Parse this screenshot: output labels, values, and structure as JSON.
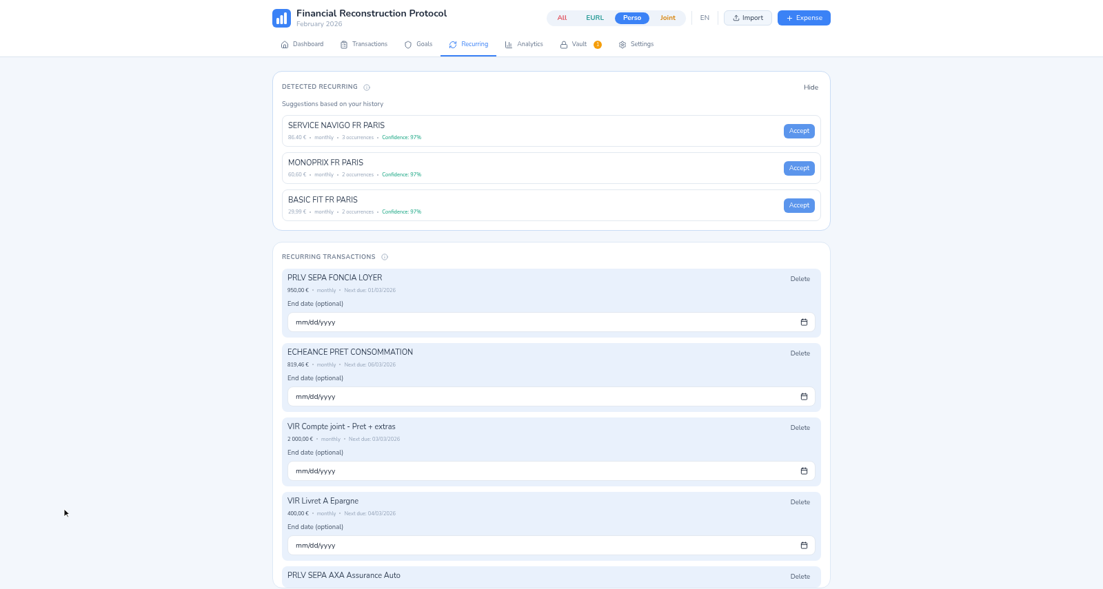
{
  "header": {
    "title": "Financial Reconstruction Protocol",
    "subtitle": "February 2026",
    "scopes": [
      {
        "label": "All",
        "selected": false,
        "color": "#e0525e"
      },
      {
        "label": "EURL",
        "selected": false,
        "color": "#2f9e9a"
      },
      {
        "label": "Perso",
        "selected": true,
        "color": "#3b82f6"
      },
      {
        "label": "Joint",
        "selected": false,
        "color": "#d9860f"
      }
    ],
    "language": "EN",
    "import": "Import",
    "expense": "Expense"
  },
  "tabs": [
    {
      "label": "Dashboard",
      "selected": false
    },
    {
      "label": "Transactions",
      "selected": false
    },
    {
      "label": "Goals",
      "selected": false
    },
    {
      "label": "Recurring",
      "selected": true
    },
    {
      "label": "Analytics",
      "selected": false
    },
    {
      "label": "Vault",
      "selected": false,
      "badge": "1"
    },
    {
      "label": "Settings",
      "selected": false
    }
  ],
  "detected": {
    "title": "DETECTED RECURRING",
    "hide": "Hide",
    "subtitle": "Suggestions based on your history",
    "items": [
      {
        "name": "SERVICE NAVIGO FR PARIS",
        "amount": "86.40 €",
        "frequency": "monthly",
        "occurrences": "3 occurrences",
        "confidence": "Confidence: 97%",
        "action": "Accept"
      },
      {
        "name": "MONOPRIX FR PARIS",
        "amount": "60,60 €",
        "frequency": "monthly",
        "occurrences": "2 occurrences",
        "confidence": "Confidence: 97%",
        "action": "Accept"
      },
      {
        "name": "BASIC FIT FR PARIS",
        "amount": "29,99 €",
        "frequency": "monthly",
        "occurrences": "2 occurrences",
        "confidence": "Confidence: 97%",
        "action": "Accept"
      }
    ]
  },
  "recurring": {
    "title": "RECURRING TRANSACTIONS",
    "items": [
      {
        "name": "PRLV SEPA FONCIA LOYER",
        "amount": "950,00 €",
        "frequency": "monthly",
        "next_due": "Next due: 01/03/2026",
        "delete": "Delete",
        "end_label": "End date (optional)",
        "placeholder": "mm/dd/yyyy"
      },
      {
        "name": "ECHEANCE PRET CONSOMMATION",
        "amount": "819,46 €",
        "frequency": "monthly",
        "next_due": "Next due: 06/03/2026",
        "delete": "Delete",
        "end_label": "End date (optional)",
        "placeholder": "mm/dd/yyyy"
      },
      {
        "name": "VIR Compte joint - Pret + extras",
        "amount": "2 000,00 €",
        "frequency": "monthly",
        "next_due": "Next due: 03/03/2026",
        "delete": "Delete",
        "end_label": "End date (optional)",
        "placeholder": "mm/dd/yyyy"
      },
      {
        "name": "VIR Livret A Epargne",
        "amount": "400,00 €",
        "frequency": "monthly",
        "next_due": "Next due: 04/03/2026",
        "delete": "Delete",
        "end_label": "End date (optional)",
        "placeholder": "mm/dd/yyyy"
      },
      {
        "name": "PRLV SEPA AXA Assurance Auto",
        "delete": "Delete"
      }
    ]
  }
}
